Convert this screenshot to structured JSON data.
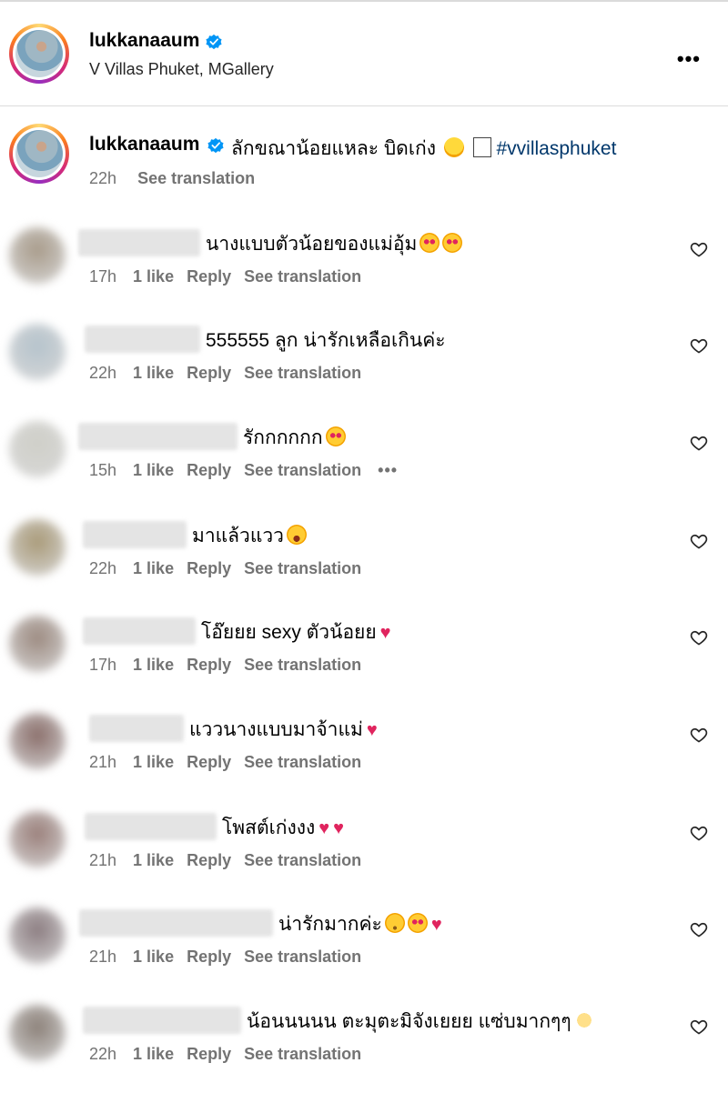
{
  "post": {
    "username": "lukkanaaum",
    "location": "V Villas Phuket, MGallery",
    "more_label": "•••"
  },
  "caption": {
    "username": "lukkanaaum",
    "text": "ลักขณาน้อยแหละ บิดเก่ง",
    "hashtag": "#vvillasphuket",
    "time": "22h",
    "see_translation": "See translation"
  },
  "colors": {
    "link": "#00376b",
    "meta": "#737373",
    "heart_red": "#e0245e"
  },
  "comments": [
    {
      "text": "นางแบบตัวน้อยของแม่อุ้ม",
      "time": "17h",
      "likes": "1 like",
      "reply": "Reply",
      "see_translation": "See translation",
      "emojis": [
        "heart-eyes",
        "heart-eyes"
      ]
    },
    {
      "text": "555555 ลูก น่ารักเหลือเกินค่ะ",
      "time": "22h",
      "likes": "1 like",
      "reply": "Reply",
      "see_translation": "See translation",
      "emojis": []
    },
    {
      "text": "รักกกกกก",
      "time": "15h",
      "likes": "1 like",
      "reply": "Reply",
      "see_translation": "See translation",
      "emojis": [
        "heart-eyes"
      ],
      "more": "•••"
    },
    {
      "text": "มาแล้วแวว",
      "time": "22h",
      "likes": "1 like",
      "reply": "Reply",
      "see_translation": "See translation",
      "emojis": [
        "grinning-squint"
      ]
    },
    {
      "text": "โอ๊ยยย sexy ตัวน้อยย",
      "time": "17h",
      "likes": "1 like",
      "reply": "Reply",
      "see_translation": "See translation",
      "emojis": [
        "red-heart"
      ]
    },
    {
      "text": "แววนางแบบมาจ้าแม่",
      "time": "21h",
      "likes": "1 like",
      "reply": "Reply",
      "see_translation": "See translation",
      "emojis": [
        "red-heart"
      ]
    },
    {
      "text": "โพสต์เก่งงง",
      "time": "21h",
      "likes": "1 like",
      "reply": "Reply",
      "see_translation": "See translation",
      "emojis": [
        "red-heart",
        "red-heart"
      ]
    },
    {
      "text": "น่ารักมากค่ะ",
      "time": "21h",
      "likes": "1 like",
      "reply": "Reply",
      "see_translation": "See translation",
      "emojis": [
        "smiling",
        "heart-eyes",
        "red-heart"
      ]
    },
    {
      "text": "น้อนนนนน ตะมุตะมิจังเยยย แซ่บมากๆๆ",
      "time": "22h",
      "likes": "1 like",
      "reply": "Reply",
      "see_translation": "See translation",
      "emojis": [
        "yellow-heart-hands"
      ]
    }
  ]
}
